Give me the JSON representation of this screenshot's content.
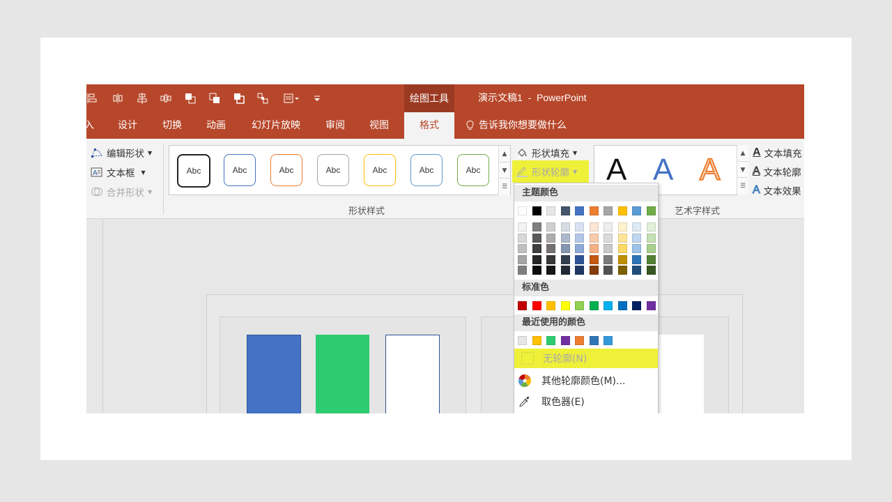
{
  "window": {
    "context_tab": "绘图工具",
    "title": "演示文稿1  -  PowerPoint"
  },
  "qat": {
    "icons": [
      "align-icon",
      "distribute-icon",
      "align-center-icon",
      "distribute-horizontal-icon",
      "bring-forward-icon",
      "send-backward-icon",
      "selection-pane-icon",
      "group-icon",
      "more-commands-icon",
      "customize-qat-icon"
    ]
  },
  "tabs": [
    {
      "label": "入"
    },
    {
      "label": "设计"
    },
    {
      "label": "切换"
    },
    {
      "label": "动画"
    },
    {
      "label": "幻灯片放映"
    },
    {
      "label": "审阅"
    },
    {
      "label": "视图"
    },
    {
      "label": "格式"
    }
  ],
  "tell_me": "告诉我你想要做什么",
  "ribbon": {
    "insert_shapes": {
      "edit_shape": "编辑形状",
      "text_box": "文本框",
      "merge_shapes": "合并形状"
    },
    "shape_styles": {
      "label": "形状样式",
      "presets": [
        {
          "text": "Abc",
          "color": "#222222"
        },
        {
          "text": "Abc",
          "color": "#4472c4"
        },
        {
          "text": "Abc",
          "color": "#ed7d31"
        },
        {
          "text": "Abc",
          "color": "#a5a5a5"
        },
        {
          "text": "Abc",
          "color": "#ffc000"
        },
        {
          "text": "Abc",
          "color": "#5b9bd5"
        },
        {
          "text": "Abc",
          "color": "#70ad47"
        }
      ],
      "shape_fill": "形状填充",
      "shape_outline": "形状轮廓"
    },
    "wordart": {
      "label": "艺术字样式",
      "letter": "A",
      "text_fill": "文本填充",
      "text_outline": "文本轮廓",
      "text_effects": "文本效果"
    }
  },
  "outline_menu": {
    "theme_colors_label": "主题颜色",
    "theme_colors": [
      "#ffffff",
      "#000000",
      "#e7e6e6",
      "#44546a",
      "#4472c4",
      "#ed7d31",
      "#a5a5a5",
      "#ffc000",
      "#5b9bd5",
      "#70ad47"
    ],
    "theme_shades": [
      [
        "#f2f2f2",
        "#7f7f7f",
        "#d0cece",
        "#d6dce4",
        "#d9e2f3",
        "#fbe5d5",
        "#ededed",
        "#fff2cc",
        "#deebf6",
        "#e2efd9"
      ],
      [
        "#d8d8d8",
        "#595959",
        "#aeabab",
        "#adb9ca",
        "#b4c6e7",
        "#f7cbac",
        "#dbdbdb",
        "#fee599",
        "#bdd7ee",
        "#c5e0b3"
      ],
      [
        "#bfbfbf",
        "#3f3f3f",
        "#757070",
        "#8496b0",
        "#8eaadb",
        "#f4b183",
        "#c9c9c9",
        "#ffd965",
        "#9dc3e6",
        "#a8d08d"
      ],
      [
        "#a5a5a5",
        "#262626",
        "#3a3838",
        "#323f4f",
        "#2f5496",
        "#c45911",
        "#7b7b7b",
        "#bf9000",
        "#2e75b5",
        "#538135"
      ],
      [
        "#7f7f7f",
        "#0c0c0c",
        "#171616",
        "#222a35",
        "#1f3864",
        "#833c0b",
        "#525252",
        "#7f6000",
        "#1e4e79",
        "#375623"
      ]
    ],
    "standard_colors_label": "标准色",
    "standard_colors": [
      "#c00000",
      "#ff0000",
      "#ffc000",
      "#ffff00",
      "#92d050",
      "#00b050",
      "#00b0f0",
      "#0070c0",
      "#002060",
      "#7030a0"
    ],
    "recent_colors_label": "最近使用的颜色",
    "recent_colors": [
      "#e7e6e6",
      "#ffc000",
      "#2ecc71",
      "#7030a0",
      "#ed7d31",
      "#2e75b5",
      "#3498db"
    ],
    "no_outline": "无轮廓(N)",
    "more_colors": "其他轮廓颜色(M)...",
    "eyedropper": "取色器(E)",
    "highlight_color": "#eef03a"
  },
  "canvas": {
    "bars": [
      {
        "color": "#4472c4"
      },
      {
        "color": "#2ecc71"
      },
      {
        "color": "#ffffff"
      }
    ]
  }
}
